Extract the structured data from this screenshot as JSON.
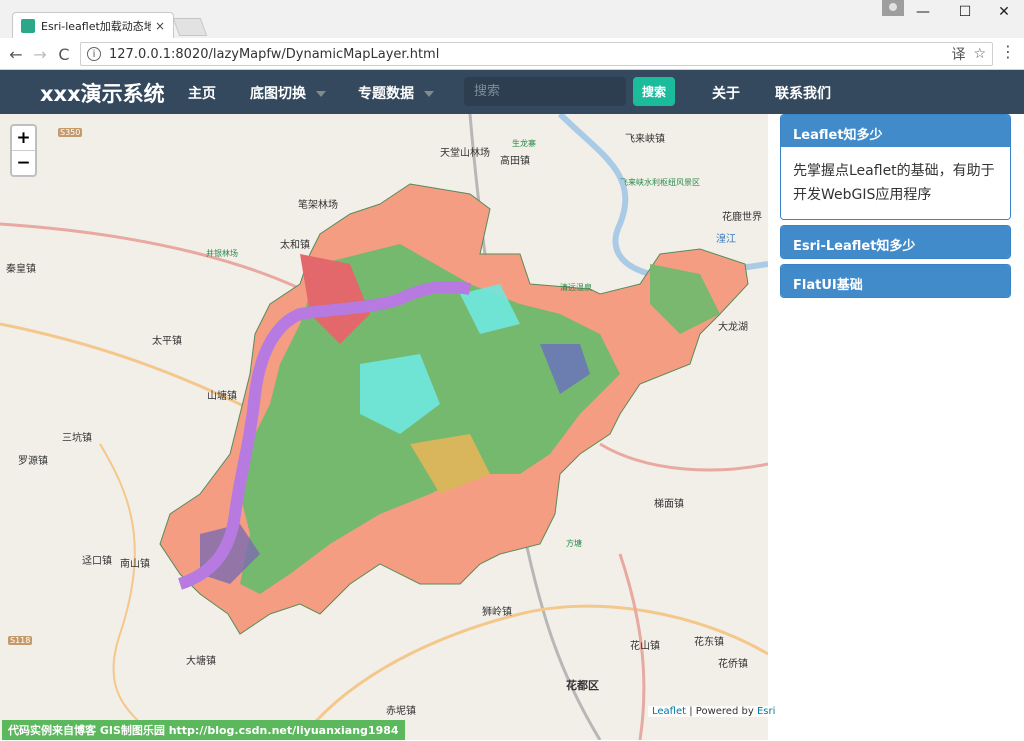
{
  "browser": {
    "tab_title": "Esri-leaflet加载动态地图",
    "tab_close": "×",
    "url": "127.0.0.1:8020/lazyMapfw/DynamicMapLayer.html",
    "back": "←",
    "forward": "→",
    "reload": "C",
    "translate_icon": "译",
    "bookmark_icon": "☆",
    "menu": "⋮",
    "minimize": "—",
    "maximize": "☐",
    "close": "✕"
  },
  "navbar": {
    "brand": "xxx演示系统",
    "home": "主页",
    "basemap": "底图切换",
    "thematic": "专题数据",
    "search_placeholder": "搜索",
    "search_button": "搜索",
    "about": "关于",
    "contact": "联系我们"
  },
  "map": {
    "zoom_in": "+",
    "zoom_out": "−",
    "attribution_leaflet": "Leaflet",
    "attribution_sep": " | Powered by ",
    "attribution_esri": "Esri",
    "credit": "代码实例来自博客 GIS制图乐园 http://blog.csdn.net/liyuanxiang1984",
    "labels": {
      "tiantang": "天堂山林场",
      "gaotian": "高田镇",
      "feilaixia": "飞来峡镇",
      "bijia": "笔架林场",
      "taihe": "太和镇",
      "qinhuang": "秦皇镇",
      "taiping": "太平镇",
      "shantang": "山塘镇",
      "sankeng": "三坑镇",
      "luoyuan": "罗源镇",
      "tiekou": "迳口镇",
      "nanshan": "南山镇",
      "datang": "大塘镇",
      "chipi": "赤坭镇",
      "huadu": "花都区",
      "shiling": "狮岭镇",
      "huashan": "花山镇",
      "huadong": "花东镇",
      "huaqiao": "花侨镇",
      "titian": "梯面镇",
      "dalonghu": "大龙湖",
      "huaxie": "花鹿世界",
      "s350": "S350",
      "s118": "S118",
      "jingli": "井银林场",
      "shenglong": "生龙寨",
      "feilai_park": "飞来峡水利枢纽风景区",
      "qingyuan_hot": "清远温泉",
      "fangbiao": "方塘",
      "huachi": "湟江"
    }
  },
  "sidebar": {
    "panels": [
      {
        "title": "Leaflet知多少",
        "body": "先掌握点Leaflet的基础，有助于开发WebGIS应用程序"
      },
      {
        "title": "Esri-Leaflet知多少"
      },
      {
        "title": "FlatUI基础"
      }
    ]
  },
  "colors": {
    "navbar": "#34495e",
    "search_btn": "#1abc9c",
    "panel_heading": "#428bca",
    "credit_bg": "#5cb85c"
  }
}
